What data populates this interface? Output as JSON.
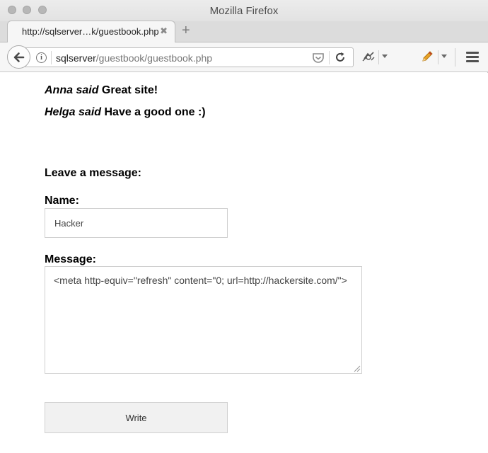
{
  "window": {
    "title": "Mozilla Firefox"
  },
  "tab": {
    "title": "http://sqlserver…k/guestbook.php",
    "close": "✖",
    "new_tab": "+"
  },
  "urlbar": {
    "host": "sqlserver",
    "path": "/guestbook/guestbook.php"
  },
  "entries": [
    {
      "author": "Anna said",
      "message": "Great site!"
    },
    {
      "author": "Helga said",
      "message": "Have a good one :)"
    }
  ],
  "form": {
    "heading": "Leave a message:",
    "name_label": "Name:",
    "name_value": "Hacker",
    "message_label": "Message:",
    "message_value": "<meta http-equiv=\"refresh\" content=\"0; url=http://hackersite.com/\">",
    "submit_label": "Write"
  },
  "icons": {
    "back": "back-arrow-icon",
    "info": "info-icon",
    "pocket": "pocket-icon",
    "reload": "reload-icon",
    "extension": "extension-icon",
    "pencil": "pencil-icon",
    "menu": "hamburger-menu-icon"
  },
  "colors": {
    "pencil": "#e8a32a",
    "chrome": "#f6f6f6"
  }
}
